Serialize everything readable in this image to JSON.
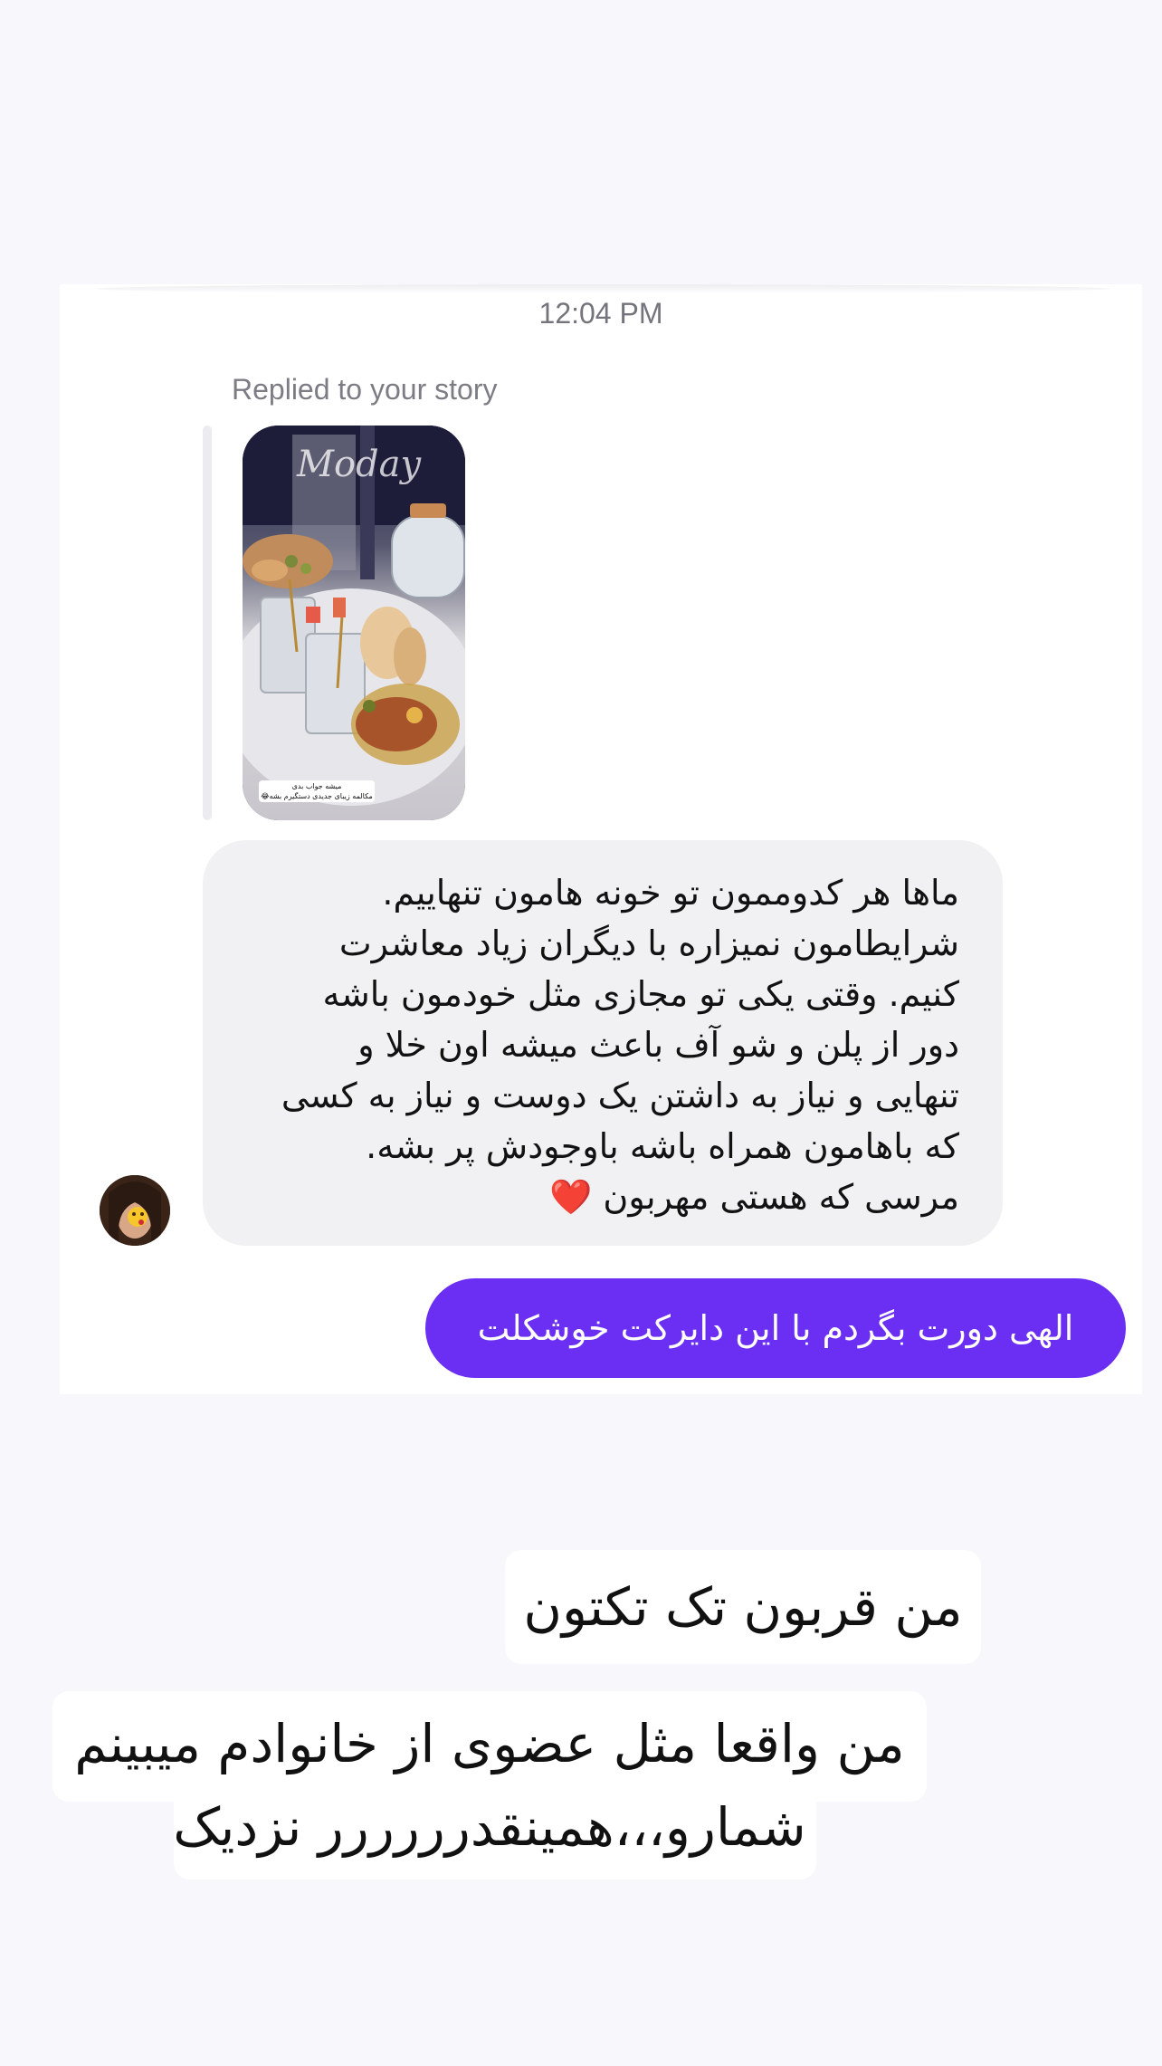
{
  "conversation": {
    "timestamp": "12:04 PM",
    "reply_label": "Replied to your story",
    "story": {
      "thumbnail": "story-photo-breakfast-table",
      "brand_text": "Moday",
      "caption": "میشه جواب بدی\nمکالمه زیبای جدیدی دستگیرم بشه😂"
    },
    "received_message": "ماها هر کدوممون تو خونه هامون تنهاییم.\nشرایطامون نمیزاره با دیگران زیاد معاشرت\nکنیم. وقتی یکی تو مجازی مثل خودمون باشه\nدور از پلن و شو آف باعث میشه اون خلا و\nتنهایی و نیاز به داشتن یک دوست و نیاز به کسی\nکه باهامون همراه باشه باوجودش پر بشه.\nمرسی که هستی مهربون ❤️",
    "sent_message": "الهی دورت بگردم با این دایرکت خوشکلت",
    "avatar": "user-avatar"
  },
  "stickers": {
    "line1": "من قربون تک تکتون",
    "line2": "من واقعا مثل عضوی از خانوادم میبینم\nشمارو،،،همینقدرررررر نزدیک"
  },
  "colors": {
    "background": "#f8f7fb",
    "sent_bubble": "#6a2ff3",
    "received_bubble": "#f1f1f3",
    "meta_text": "#74747c"
  }
}
